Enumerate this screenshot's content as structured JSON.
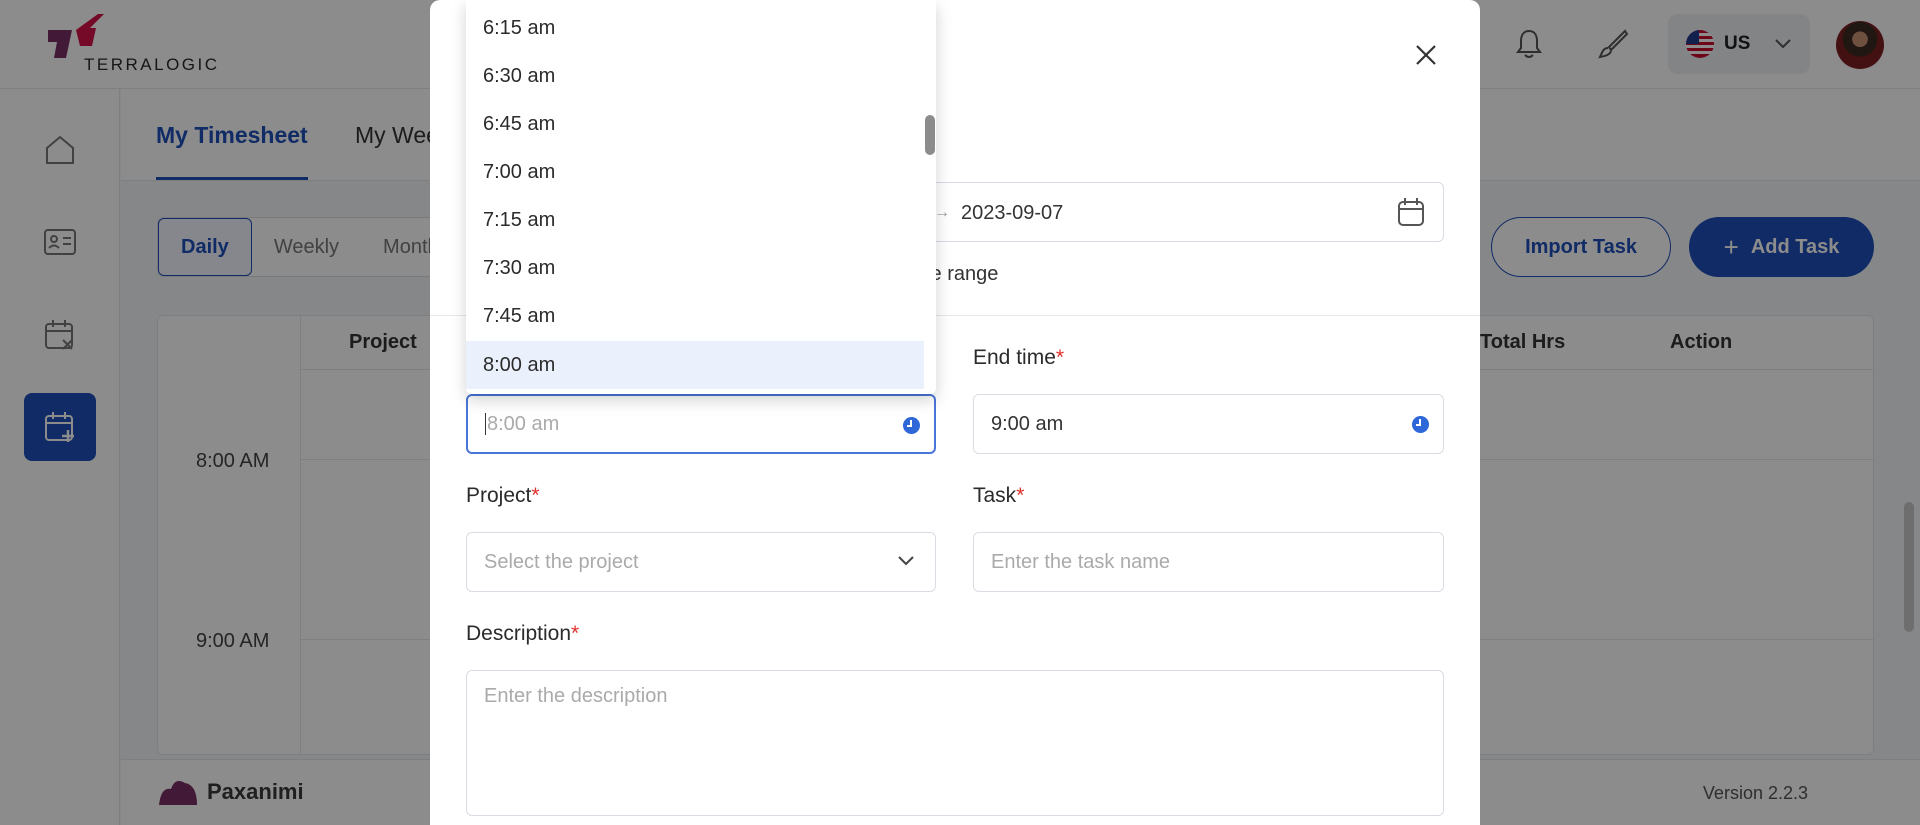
{
  "brand": {
    "name": "TERRALOGIC"
  },
  "header": {
    "language_code": "US"
  },
  "tabs": [
    {
      "label": "My Timesheet"
    },
    {
      "label": "My Weekly"
    }
  ],
  "view_toggle": [
    "Daily",
    "Weekly",
    "Monthly"
  ],
  "actions": {
    "import_label": "Import Task",
    "add_label": "Add Task"
  },
  "grid": {
    "columns": [
      "Project",
      "Total Hrs",
      "Action"
    ],
    "times": [
      "8:00 AM",
      "9:00 AM"
    ]
  },
  "footer": {
    "brand": "Paxanimi",
    "version": "Version 2.2.3"
  },
  "modal": {
    "date_value": "2023-09-07",
    "range_text": "te range",
    "start_time_value": "8:00 am",
    "end_time_label": "End time",
    "end_time_value": "9:00 am",
    "project_label": "Project",
    "project_placeholder": "Select the project",
    "task_label": "Task",
    "task_placeholder": "Enter the task name",
    "description_label": "Description",
    "description_placeholder": "Enter the description",
    "required_mark": "*"
  },
  "time_dropdown": {
    "options": [
      "6:15 am",
      "6:30 am",
      "6:45 am",
      "7:00 am",
      "7:15 am",
      "7:30 am",
      "7:45 am",
      "8:00 am"
    ],
    "selected": "8:00 am"
  },
  "colors": {
    "primary": "#1e4fb8",
    "required": "#e0312c",
    "selected_option_bg": "#eaf1fc"
  }
}
